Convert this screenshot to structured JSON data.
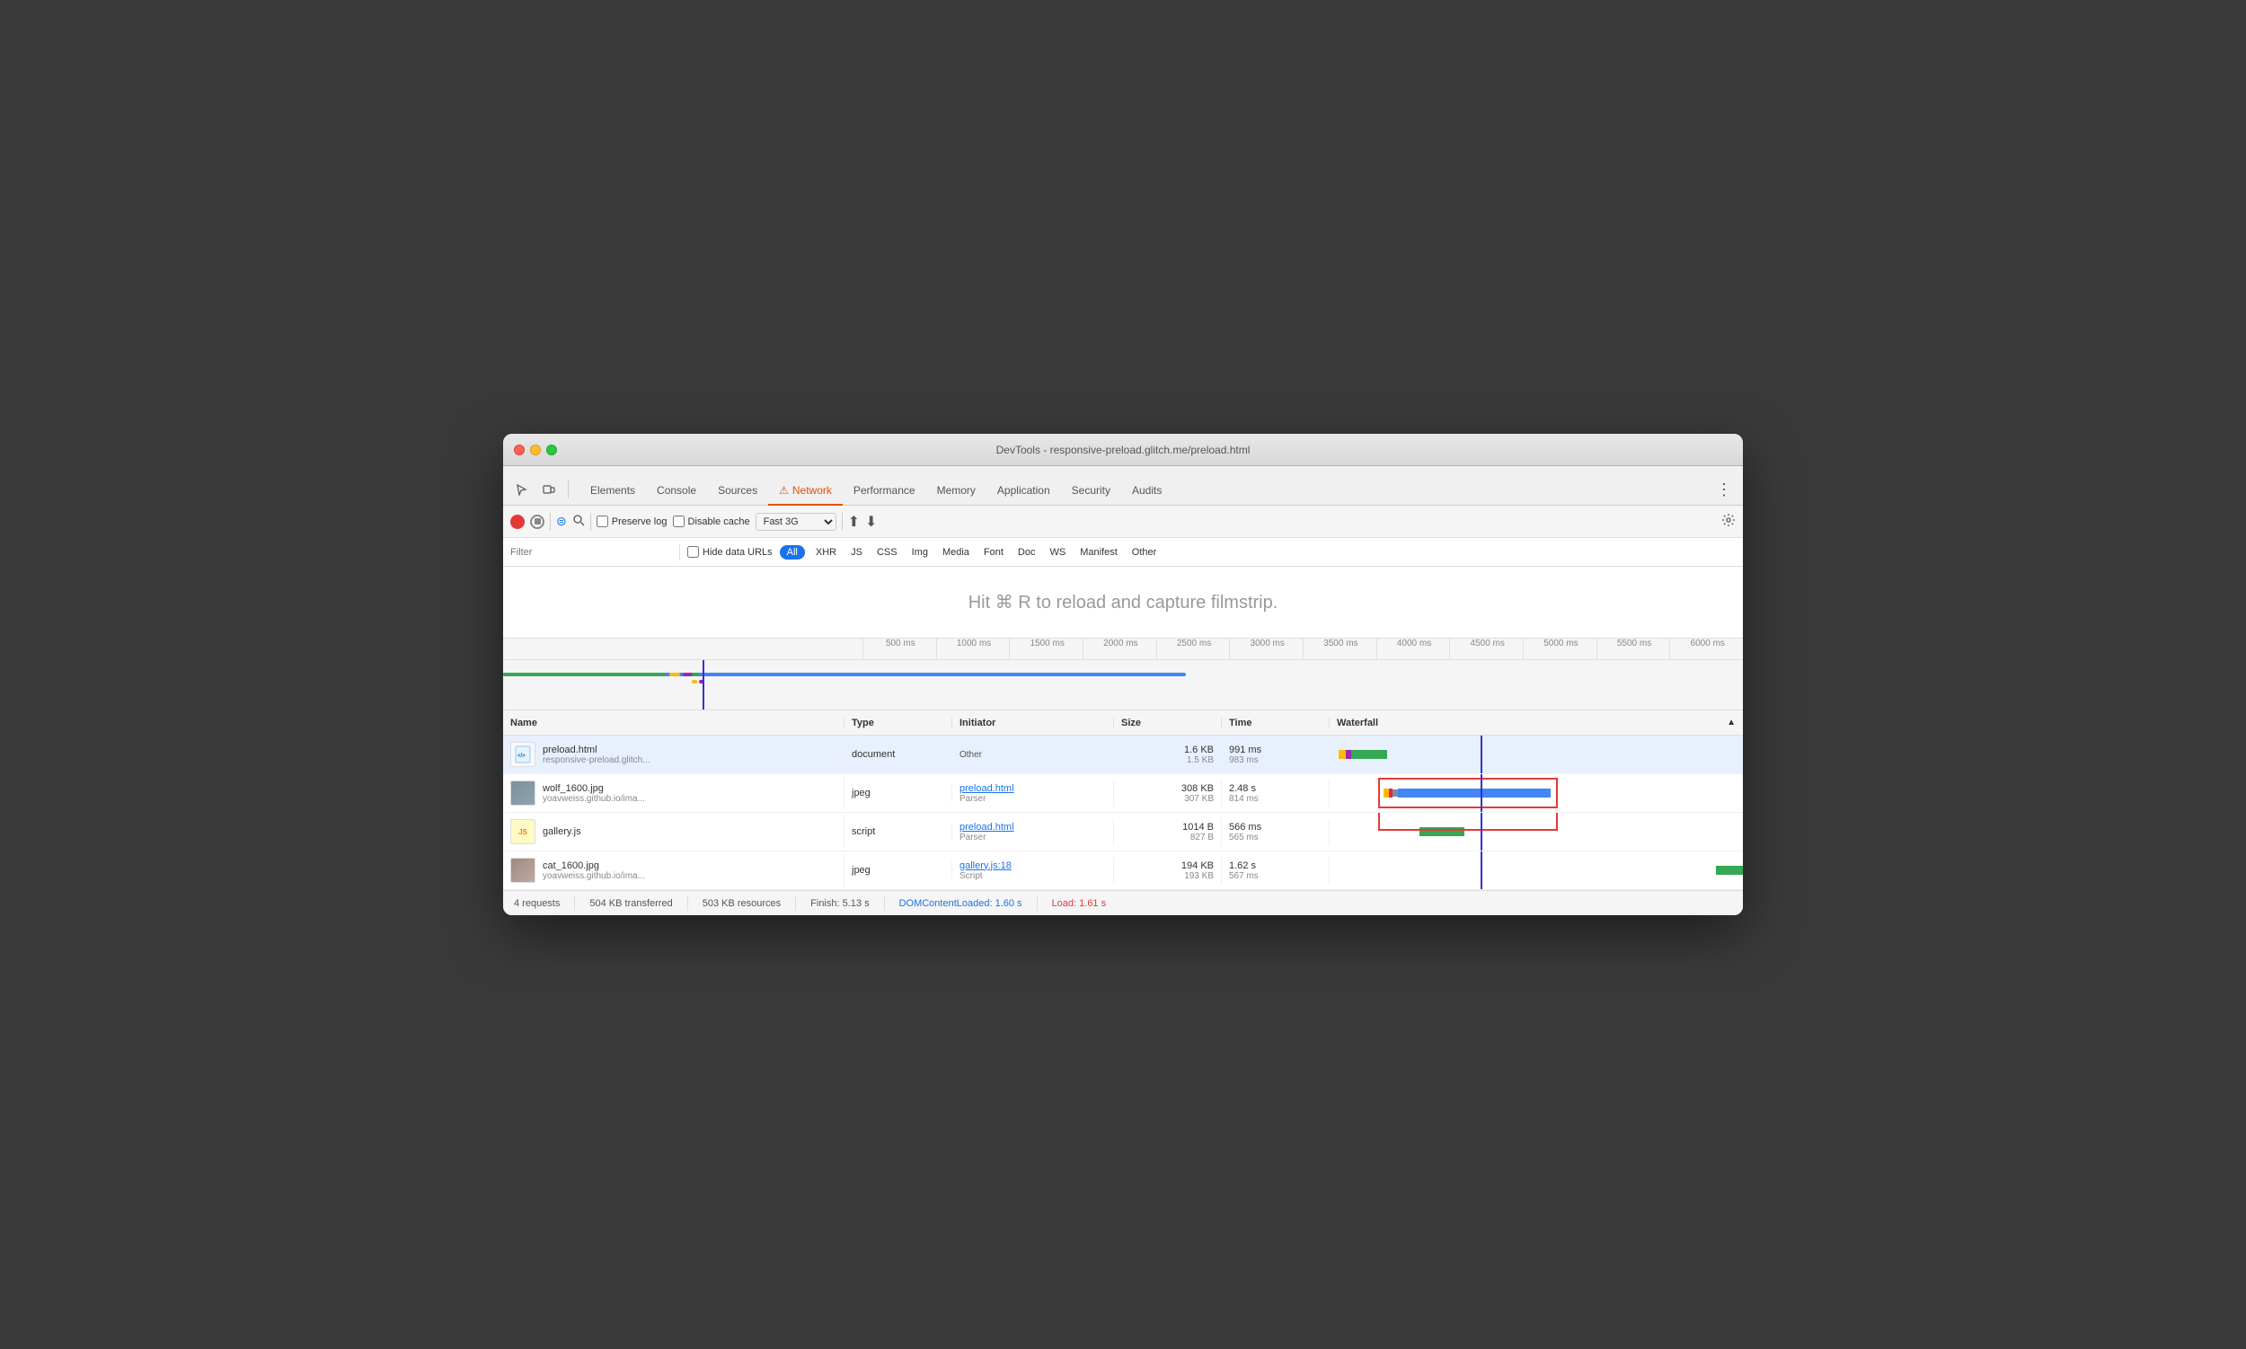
{
  "window": {
    "title": "DevTools - responsive-preload.glitch.me/preload.html"
  },
  "tabs": [
    {
      "label": "Elements",
      "active": false
    },
    {
      "label": "Console",
      "active": false
    },
    {
      "label": "Sources",
      "active": false
    },
    {
      "label": "Network",
      "active": true,
      "warning": true
    },
    {
      "label": "Performance",
      "active": false
    },
    {
      "label": "Memory",
      "active": false
    },
    {
      "label": "Application",
      "active": false
    },
    {
      "label": "Security",
      "active": false
    },
    {
      "label": "Audits",
      "active": false
    }
  ],
  "toolbar": {
    "preserve_log_label": "Preserve log",
    "disable_cache_label": "Disable cache",
    "throttle_label": "Fast 3G"
  },
  "filter_bar": {
    "placeholder": "Filter",
    "hide_data_urls_label": "Hide data URLs",
    "buttons": [
      "All",
      "XHR",
      "JS",
      "CSS",
      "Img",
      "Media",
      "Font",
      "Doc",
      "WS",
      "Manifest",
      "Other"
    ]
  },
  "filmstrip": {
    "hint": "Hit ⌘ R to reload and capture filmstrip."
  },
  "timeline": {
    "marks": [
      "500 ms",
      "1000 ms",
      "1500 ms",
      "2000 ms",
      "2500 ms",
      "3000 ms",
      "3500 ms",
      "4000 ms",
      "4500 ms",
      "5000 ms",
      "5500 ms",
      "6000 ms"
    ]
  },
  "table": {
    "headers": [
      "Name",
      "Type",
      "Initiator",
      "Size",
      "Time",
      "Waterfall"
    ],
    "rows": [
      {
        "name": "preload.html",
        "url": "responsive-preload.glitch...",
        "type": "document",
        "initiator_name": "Other",
        "initiator_link": false,
        "size1": "1.6 KB",
        "size2": "1.5 KB",
        "time1": "991 ms",
        "time2": "983 ms",
        "selected": true,
        "icon_type": "html"
      },
      {
        "name": "wolf_1600.jpg",
        "url": "yoavweiss.github.io/ima...",
        "type": "jpeg",
        "initiator_name": "preload.html",
        "initiator_sub": "Parser",
        "initiator_link": true,
        "size1": "308 KB",
        "size2": "307 KB",
        "time1": "2.48 s",
        "time2": "814 ms",
        "selected": false,
        "icon_type": "img"
      },
      {
        "name": "gallery.js",
        "url": "",
        "type": "script",
        "initiator_name": "preload.html",
        "initiator_sub": "Parser",
        "initiator_link": true,
        "size1": "1014 B",
        "size2": "827 B",
        "time1": "566 ms",
        "time2": "565 ms",
        "selected": false,
        "icon_type": "js"
      },
      {
        "name": "cat_1600.jpg",
        "url": "yoavweiss.github.io/ima...",
        "type": "jpeg",
        "initiator_name": "gallery.js:18",
        "initiator_sub": "Script",
        "initiator_link": true,
        "size1": "194 KB",
        "size2": "193 KB",
        "time1": "1.62 s",
        "time2": "567 ms",
        "selected": false,
        "icon_type": "img"
      }
    ]
  },
  "status_bar": {
    "requests": "4 requests",
    "transferred": "504 KB transferred",
    "resources": "503 KB resources",
    "finish": "Finish: 5.13 s",
    "dom_content_loaded": "DOMContentLoaded: 1.60 s",
    "load": "Load: 1.61 s"
  }
}
